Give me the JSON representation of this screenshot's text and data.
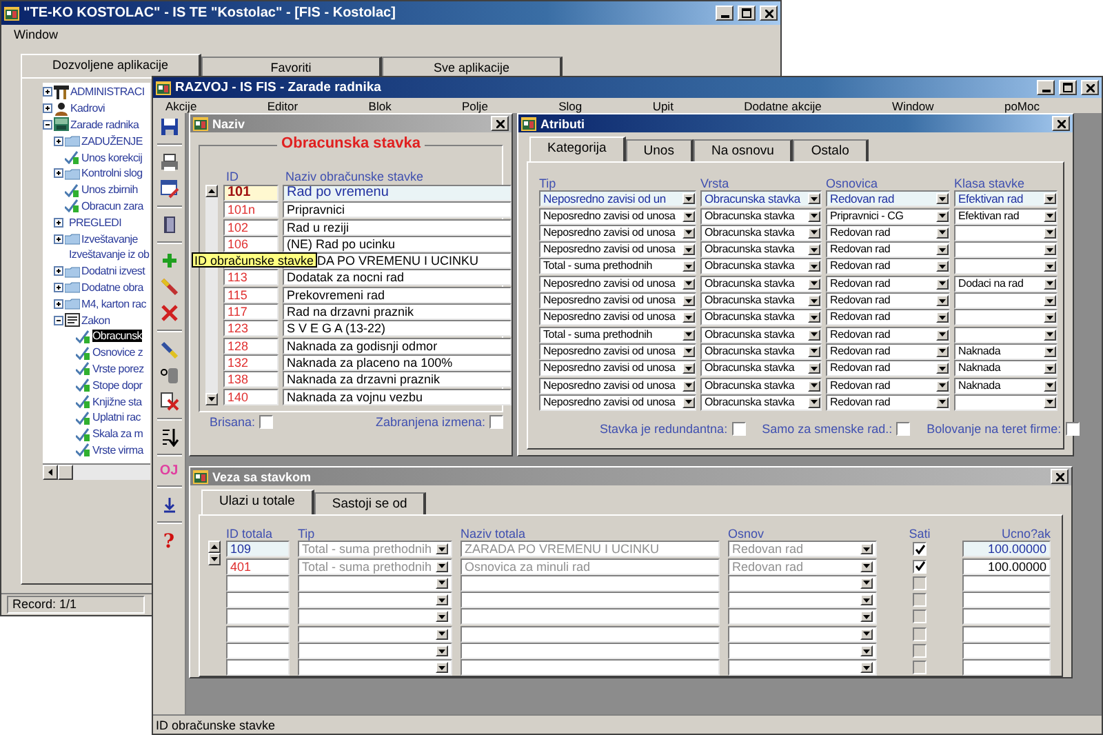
{
  "main_window": {
    "title": "\"TE-KO KOSTOLAC\" - IS TE \"Kostolac\" - [FIS - Kostolac]",
    "menu": [
      "Window"
    ],
    "tabs": [
      {
        "label": "Dozvoljene aplikacije",
        "selected": true
      },
      {
        "label": "Favoriti",
        "selected": false
      },
      {
        "label": "Sve aplikacije",
        "selected": false
      }
    ],
    "tree": [
      {
        "label": "ADMINISTRACI",
        "kind": "tool",
        "expanded": false,
        "selected": false
      },
      {
        "label": "Kadrovi",
        "kind": "person",
        "expanded": false,
        "selected": false
      },
      {
        "label": "Zarade radnika",
        "kind": "module",
        "expanded": true,
        "selected": false,
        "children": [
          {
            "label": "ZADUŽENJE",
            "kind": "folder",
            "expanded": false,
            "selected": false
          },
          {
            "label": "Unos korekcij",
            "kind": "leaf",
            "selected": false
          },
          {
            "label": "Kontrolni slog",
            "kind": "folder",
            "expanded": false,
            "selected": false
          },
          {
            "label": "Unos zbirnih",
            "kind": "leaf",
            "selected": false
          },
          {
            "label": "Obracun zara",
            "kind": "leaf",
            "selected": false
          },
          {
            "label": "PREGLEDI",
            "kind": "plain",
            "expanded": false,
            "selected": false
          },
          {
            "label": "Izveštavanje",
            "kind": "folder",
            "expanded": false,
            "selected": false
          },
          {
            "label": "Izveštavanje iz ob",
            "kind": "plain",
            "selected": false
          },
          {
            "label": "Dodatni izvest",
            "kind": "folder",
            "expanded": false,
            "selected": false
          },
          {
            "label": "Dodatne obra",
            "kind": "folder",
            "expanded": false,
            "selected": false
          },
          {
            "label": "M4, karton rac",
            "kind": "folder",
            "expanded": false,
            "selected": false
          },
          {
            "label": "Zakon",
            "kind": "book",
            "expanded": true,
            "selected": false,
            "children": [
              {
                "label": "Obracunsk",
                "kind": "leaf",
                "selected": true
              },
              {
                "label": "Osnovice z",
                "kind": "leaf",
                "selected": false
              },
              {
                "label": "Vrste porez",
                "kind": "leaf",
                "selected": false
              },
              {
                "label": "Stope dopr",
                "kind": "leaf",
                "selected": false
              },
              {
                "label": "Knjižne sta",
                "kind": "leaf",
                "selected": false
              },
              {
                "label": "Uplatni rac",
                "kind": "leaf",
                "selected": false
              },
              {
                "label": "Skala za m",
                "kind": "leaf",
                "selected": false
              },
              {
                "label": "Vrste virma",
                "kind": "leaf",
                "selected": false
              }
            ]
          }
        ]
      }
    ],
    "status_bar": "Record: 1/1"
  },
  "app_window": {
    "title": "RAZVOJ - IS FIS - Zarade radnika",
    "menu": [
      "Akcije",
      "Editor",
      "Blok",
      "Polje",
      "Slog",
      "Upit",
      "Dodatne akcije",
      "Window",
      "poMoc"
    ],
    "toolbar_labels": [
      "OJ",
      "?"
    ],
    "status_bar": "ID obračunske stavke"
  },
  "naziv": {
    "title": "Naziv",
    "heading": "Obracunska stavka",
    "columns": [
      "ID",
      "Naziv obračunske stavke"
    ],
    "rows": [
      {
        "id": "101",
        "name": "Rad po vremenu",
        "selected": true
      },
      {
        "id": "101n",
        "name": "Pripravnici",
        "selected": false
      },
      {
        "id": "102",
        "name": "Rad u reziji",
        "selected": false
      },
      {
        "id": "106",
        "name": "(NE) Rad po ucinku",
        "selected": false
      },
      {
        "name": "DA PO VREMENU I UCINKU",
        "selected": false
      },
      {
        "id": "113",
        "name": "Dodatak za nocni rad",
        "selected": false
      },
      {
        "id": "115",
        "name": "Prekovremeni rad",
        "selected": false
      },
      {
        "id": "117",
        "name": "Rad na drzavni praznik",
        "selected": false
      },
      {
        "id": "123",
        "name": "S V E G A (13-22)",
        "selected": false
      },
      {
        "id": "128",
        "name": "Naknada za godisnji odmor",
        "selected": false
      },
      {
        "id": "132",
        "name": "Naknada za placeno na 100%",
        "selected": false
      },
      {
        "id": "138",
        "name": "Naknada za drzavni praznik",
        "selected": false
      },
      {
        "id": "140",
        "name": "Naknada za vojnu vezbu",
        "selected": false
      }
    ],
    "checkboxes": [
      {
        "label": "Brisana:",
        "checked": false
      },
      {
        "label": "Zabranjena izmena:",
        "checked": false
      }
    ]
  },
  "tooltip": "ID obračunske stavke",
  "atributi": {
    "title": "Atributi",
    "tabs": [
      {
        "label": "Kategorija",
        "selected": true
      },
      {
        "label": "Unos",
        "selected": false
      },
      {
        "label": "Na osnovu",
        "selected": false
      },
      {
        "label": "Ostalo",
        "selected": false
      }
    ],
    "columns": [
      "Tip",
      "Vrsta",
      "Osnovica",
      "Klasa stavke"
    ],
    "rows": [
      {
        "tip": "Neposredno zavisi od un",
        "vrsta": "Obracunska stavka",
        "osnovica": "Redovan rad",
        "klasa": "Efektivan rad",
        "selected": true
      },
      {
        "tip": "Neposredno zavisi od unosa",
        "vrsta": "Obracunska stavka",
        "osnovica": "Pripravnici - CG",
        "klasa": "Efektivan rad",
        "selected": false
      },
      {
        "tip": "Neposredno zavisi od unosa",
        "vrsta": "Obracunska stavka",
        "osnovica": "Redovan rad",
        "selected": false
      },
      {
        "tip": "Neposredno zavisi od unosa",
        "vrsta": "Obracunska stavka",
        "osnovica": "Redovan rad",
        "selected": false
      },
      {
        "tip": "Total - suma prethodnih",
        "vrsta": "Obracunska stavka",
        "osnovica": "Redovan rad",
        "selected": false
      },
      {
        "tip": "Neposredno zavisi od unosa",
        "vrsta": "Obracunska stavka",
        "osnovica": "Redovan rad",
        "klasa": "Dodaci na rad",
        "selected": false
      },
      {
        "tip": "Neposredno zavisi od unosa",
        "vrsta": "Obracunska stavka",
        "osnovica": "Redovan rad",
        "selected": false
      },
      {
        "tip": "Neposredno zavisi od unosa",
        "vrsta": "Obracunska stavka",
        "osnovica": "Redovan rad",
        "selected": false
      },
      {
        "tip": "Total - suma prethodnih",
        "vrsta": "Obracunska stavka",
        "osnovica": "Redovan rad",
        "selected": false
      },
      {
        "tip": "Neposredno zavisi od unosa",
        "vrsta": "Obracunska stavka",
        "osnovica": "Redovan rad",
        "klasa": "Naknada",
        "selected": false
      },
      {
        "tip": "Neposredno zavisi od unosa",
        "vrsta": "Obracunska stavka",
        "osnovica": "Redovan rad",
        "klasa": "Naknada",
        "selected": false
      },
      {
        "tip": "Neposredno zavisi od unosa",
        "vrsta": "Obracunska stavka",
        "osnovica": "Redovan rad",
        "klasa": "Naknada",
        "selected": false
      },
      {
        "tip": "Neposredno zavisi od unosa",
        "vrsta": "Obracunska stavka",
        "osnovica": "Redovan rad",
        "selected": false
      }
    ],
    "checkboxes": [
      {
        "label": "Stavka je redundantna:",
        "checked": false
      },
      {
        "label": "Samo za smenske rad.:",
        "checked": false
      },
      {
        "label": "Bolovanje na teret firme:",
        "checked": false
      }
    ]
  },
  "veza": {
    "title": "Veza sa stavkom",
    "tabs": [
      {
        "label": "Ulazi u totale",
        "selected": true
      },
      {
        "label": "Sastoji se od",
        "selected": false
      }
    ],
    "columns": [
      "ID totala",
      "Tip",
      "Naziv totala",
      "Osnov",
      "Sati",
      "Ucno?ak"
    ],
    "rows": [
      {
        "id": "109",
        "tip": "Total - suma prethodnih",
        "naziv": "ZARADA PO VREMENU I UCINKU",
        "osnov": "Redovan rad",
        "sati": true,
        "iznos": "100.00000",
        "selected": true
      },
      {
        "id": "401",
        "tip": "Total - suma prethodnih",
        "naziv": "Osnovica za minuli rad",
        "osnov": "Redovan rad",
        "sati": true,
        "iznos": "100.00000",
        "selected": false
      },
      {
        "sati": false,
        "selected": false
      },
      {
        "sati": false,
        "selected": false
      },
      {
        "sati": false,
        "selected": false
      },
      {
        "sati": false,
        "selected": false
      },
      {
        "sati": false,
        "selected": false
      },
      {
        "sati": false,
        "selected": false
      }
    ]
  }
}
